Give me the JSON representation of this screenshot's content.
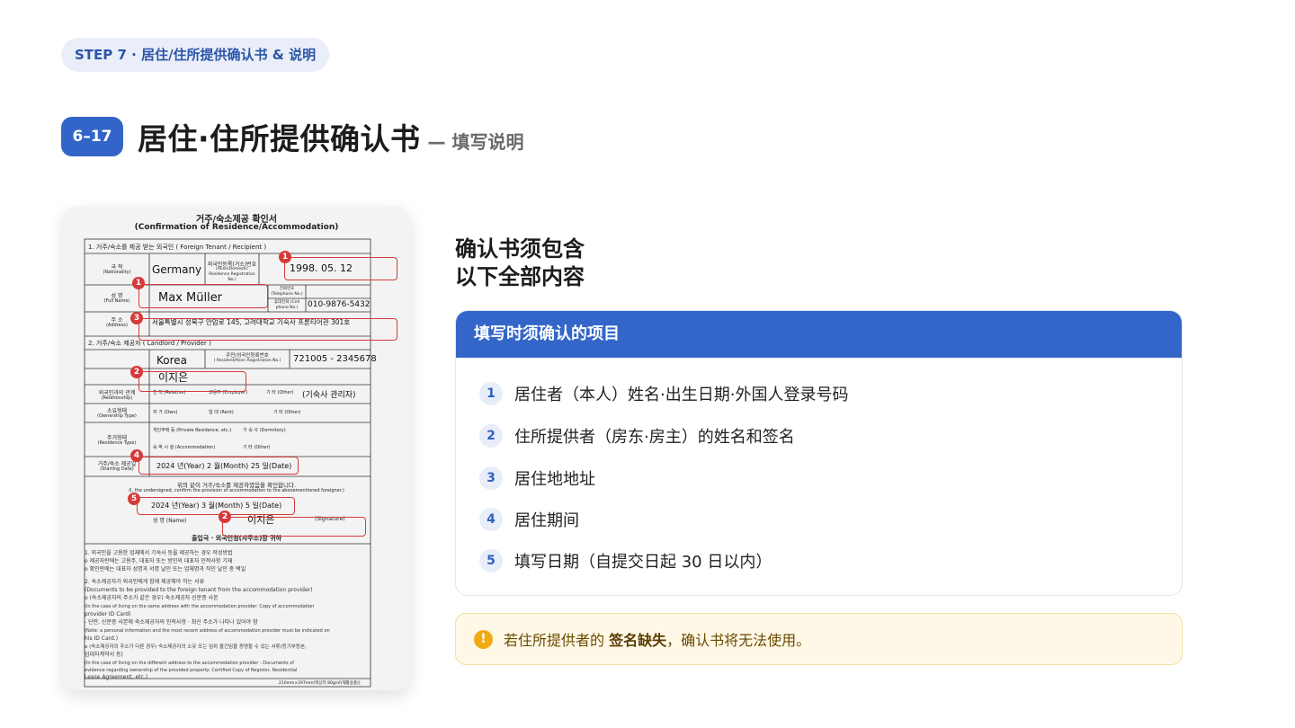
{
  "header": {
    "step_label": "STEP 7 · 居住/住所提供确认书 & 说明",
    "page_badge": "6–17",
    "title": "居住·住所提供确认书",
    "subtitle": "— 填写说明"
  },
  "document": {
    "title_ko": "거주/숙소제공 확인서",
    "title_en": "(Confirmation of Residence/Accommodation)",
    "section1": "1. 거주/숙소를 제공 받는 외국인 ( Foreign Tenant / Recipient )",
    "nationality_label": "국 적",
    "nationality_label_en": "(Nationality)",
    "nationality_value": "Germany",
    "reg_label": "외국인등록(거소)번호",
    "reg_label_en": "(Alien/Domestic Residence Registration No.)",
    "reg_value": "1998. 05. 12",
    "name_label": "성 명",
    "name_label_en": "(Full Name)",
    "name_value": "Max Müller",
    "tel_label": "전화번호 (Telephone No.)",
    "cell_label": "휴대전화 (Cell phone No.)",
    "cell_value": "010-9876-5432",
    "address_label": "주 소",
    "address_label_en": "(Address)",
    "address_value": "서울특별시 성북구 안암로 145, 고려대학교 기숙사 프론티어관 301호",
    "section2": "2. 거주/숙소 제공자 ( Landlord / Provider )",
    "provider_nationality_value": "Korea",
    "provider_reg_label": "주민/외국인등록번호",
    "provider_reg_label_en": "( Resident/Alien Registration No.)",
    "provider_reg_value": "721005 - 2345678",
    "provider_name_value": "이지은",
    "relationship_label": "외국인과의 관계",
    "relationship_label_en": "(Relationship)",
    "relationship_options": [
      "친 척 (Relative)",
      "고용주 (Employer)",
      "기 타 (Other)"
    ],
    "relationship_other": "(기숙사 관리자)",
    "ownership_label": "소유형태",
    "ownership_label_en": "(Ownership Type)",
    "ownership_options": [
      "자 가 (Own)",
      "임 대 (Rent)",
      "기 타 (Other)"
    ],
    "residence_type_label": "주거형태",
    "residence_type_label_en": "(Residence Type)",
    "residence_options": [
      "개인주택 등 (Private Residence, etc.)",
      "기 숙 사 (Dormitory)",
      "숙 박 시 설 (Accommodation)",
      "기 타 (Other)"
    ],
    "start_label": "거주/숙소 제공일",
    "start_label_en": "(Starting Date)",
    "start_value": "2024 년(Year) 2 월(Month) 25 일(Date)",
    "confirm_ko": "위의 같이 거주/숙소를 제공하였음을 확인합니다.",
    "confirm_en": "(I, the undersigned, confirm the provision of accommodation to the abovementioned foreigner.)",
    "sign_date": "2024 년(Year) 3 월(Month) 5 일(Date)",
    "sign_name_label": "성 명 (Name)",
    "sign_name_value": "이지은",
    "signature_label": "(Signature)",
    "addressee": "출입국 · 외국인청(사무소)장 귀하",
    "notes": [
      "1. 외국인을 고용한 업체에서 기숙사 등을 제공하는 경우 작성방법",
      "  o 제공자란에는 고용주, 대표자 또는 방인의 대표자 인적사항 기재",
      "  o 확인란에는 대표자 성명과 서명 날인 또는 업체명과 직인 날인 중 택일",
      "2. 숙소제공자가 외국인에게 함께 제공해야 하는 서류",
      "  (Documents to be provided to the foreign tenant from the accommodation provider)",
      "  o (숙소제공자의 주소가 같은 경우) 숙소제공자 신분증 사본",
      "  (In the case of living on the same address with the accommodation provider: Copy of accommodation",
      "  provider ID Card)",
      "  - 단만, 신분증 사본에 숙소제공자의 인적사항 · 최신 주소가 나타나 있어야 함",
      "  (Note: a personal information and the most recent address of accommodation provider must be indicated on",
      "  his ID Card.)",
      "  o (숙소제공자의 주소가 다른 경우) 숙소제공자의 소유 또는 임차 물건임을 증명할 수 있는 서류(등기부등본,",
      "  임대차계약서 등)",
      "  (In the case of living on the different address to the accommodation provider : Documents of",
      "  evidence regarding ownership of the provided property: Certified Copy of Registor, Residential",
      "  Lease Agreement, etc.)"
    ],
    "paper_spec": "210mm×297mm[백상지 80g/㎡(재활용품)]",
    "markers": [
      "1",
      "1",
      "3",
      "2",
      "4",
      "5",
      "2"
    ]
  },
  "right": {
    "heading_line1": "确认书须包含",
    "heading_line2": "以下全部内容",
    "card_title": "填写时须确认的项目",
    "items": [
      {
        "num": "1",
        "text": "居住者（本人）姓名·出生日期·外国人登录号码"
      },
      {
        "num": "2",
        "text": "住所提供者（房东·房主）的姓名和签名"
      },
      {
        "num": "3",
        "text": "居住地地址"
      },
      {
        "num": "4",
        "text": "居住期间"
      },
      {
        "num": "5",
        "text": "填写日期（自提交日起 30 日以内）"
      }
    ],
    "warning": {
      "icon": "exclamation-icon",
      "before": "若住所提供者的",
      "bold": "签名缺失",
      "after": "，确认书将无法使用。"
    }
  },
  "colors": {
    "accent": "#3366c8",
    "marker": "#d63a3a",
    "warning_bg": "#fff8e6",
    "warning_icon": "#f1aa11"
  }
}
